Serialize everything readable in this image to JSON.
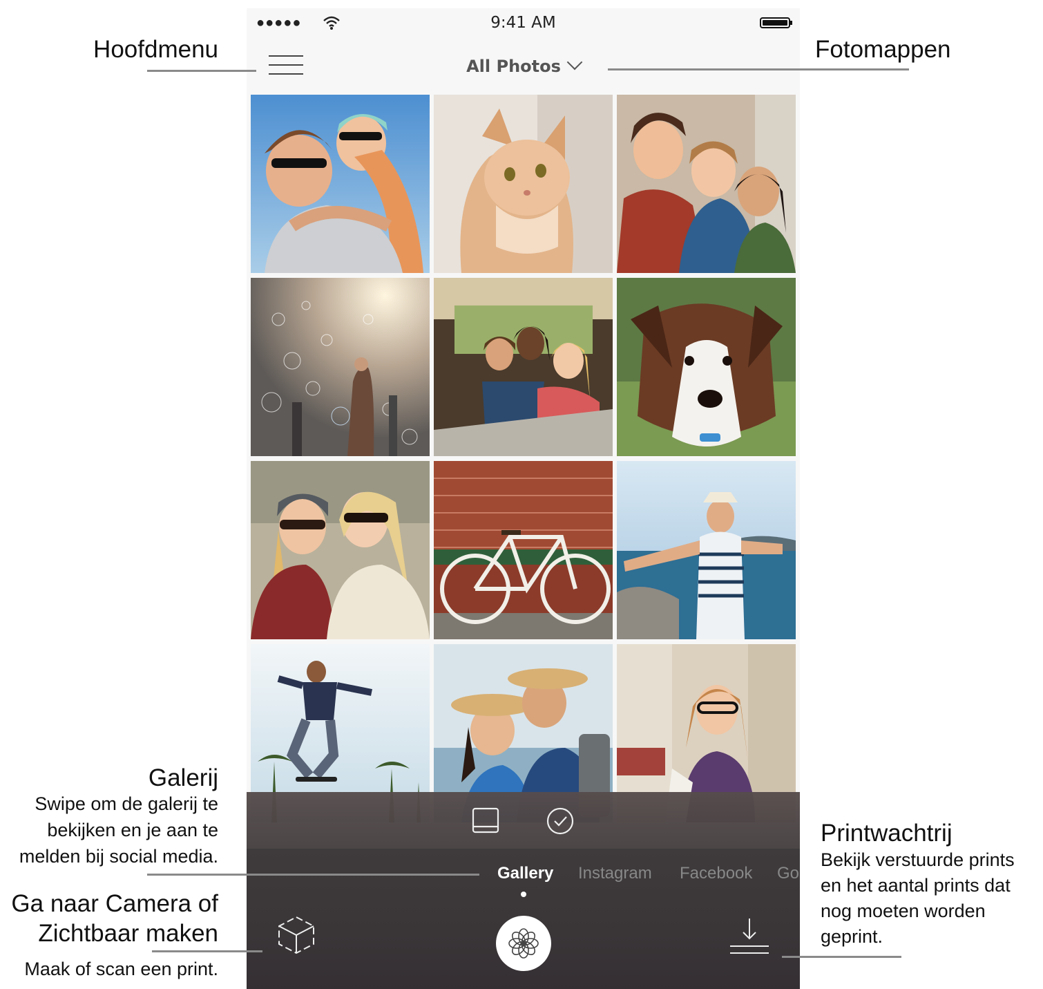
{
  "status_bar": {
    "signal": "●●●●●",
    "time": "9:41 AM",
    "icons": [
      "wifi-icon",
      "battery-icon"
    ]
  },
  "nav": {
    "menu_icon": "hamburger-icon",
    "album_title": "All Photos",
    "dropdown_icon": "chevron-down-icon"
  },
  "gallery": {
    "photos": [
      "couple-sunglasses-photo",
      "cat-photo",
      "three-friends-photo",
      "bubbles-street-photo",
      "friends-in-car-photo",
      "puppy-photo",
      "two-women-photo",
      "bicycle-brick-wall-photo",
      "man-at-lake-photo",
      "skateboarder-jump-photo",
      "couple-hats-photo",
      "woman-glasses-photo"
    ]
  },
  "toolbar": {
    "icons": [
      "print-layout-icon",
      "select-check-icon"
    ]
  },
  "tabs": {
    "items": [
      "Gallery",
      "Instagram",
      "Facebook",
      "Goo"
    ],
    "active": "Gallery"
  },
  "bottom_bar": {
    "left_icon": "camera-cube-icon",
    "center_icon": "flower-shutter-icon",
    "right_icon": "print-queue-icon"
  },
  "callouts": {
    "main_menu": "Hoofdmenu",
    "photo_folders": "Fotomappen",
    "gallery_title": "Galerij",
    "gallery_line1": "Swipe om de galerij te",
    "gallery_line2": "bekijken en je aan te",
    "gallery_line3": "melden bij social media.",
    "camera_line1": "Ga naar Camera of",
    "camera_line2": "Zichtbaar maken",
    "camera_desc": "Maak of scan een print.",
    "queue_title": "Printwachtrij",
    "queue_line1": "Bekijk verstuurde prints",
    "queue_line2": "en het aantal prints dat",
    "queue_line3": "nog moeten worden",
    "queue_line4": "geprint."
  },
  "colors": {
    "app_background": "#f7f7f7",
    "bottom_bar": "#3a3638",
    "leader_line": "#8a8a8a",
    "tab_inactive": "#888888",
    "tab_active": "#ffffff"
  }
}
